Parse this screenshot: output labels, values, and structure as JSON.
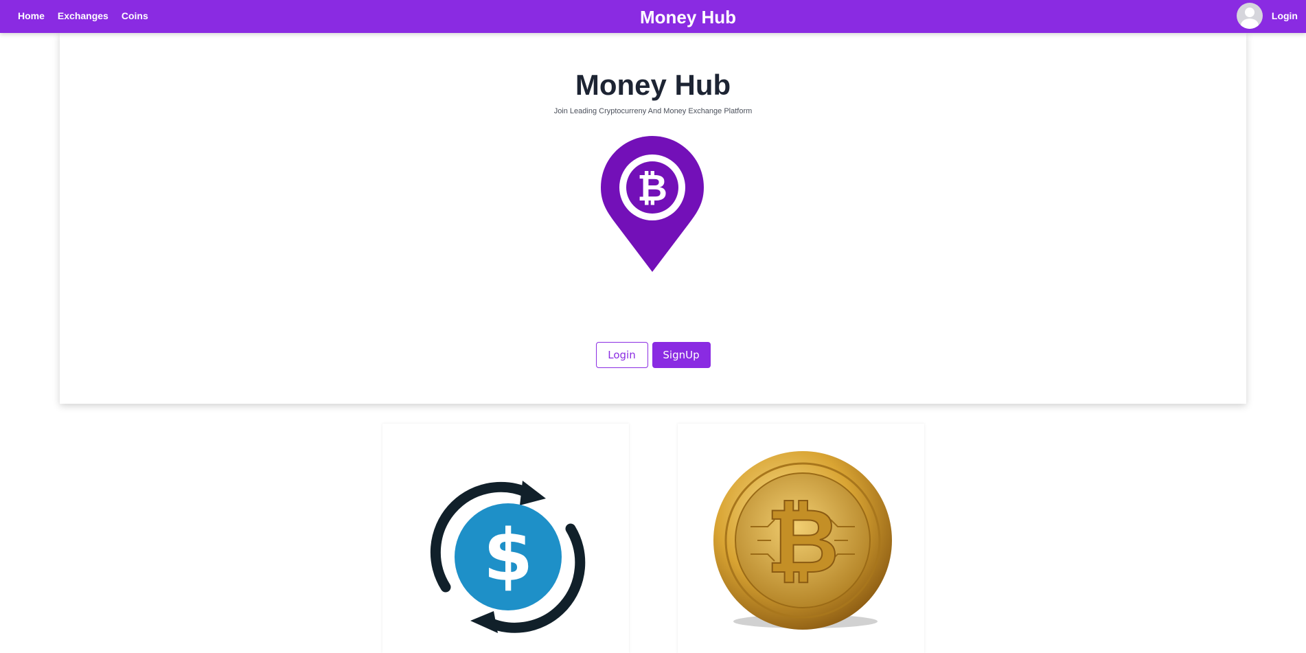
{
  "navbar": {
    "links": [
      {
        "label": "Home"
      },
      {
        "label": "Exchanges"
      },
      {
        "label": "Coins"
      }
    ],
    "brand": "Money Hub",
    "login_label": "Login"
  },
  "hero": {
    "title": "Money Hub",
    "subtitle": "Join Leading Cryptocurreny And Money Exchange Platform",
    "logo_icon": "bitcoin-location-pin-icon",
    "login_button": "Login",
    "signup_button": "SignUp"
  },
  "cards": [
    {
      "icon": "dollar-exchange-icon"
    },
    {
      "icon": "bitcoin-coin-icon"
    }
  ],
  "colors": {
    "accent": "#8a2be2",
    "logo_purple": "#7310b8",
    "dollar_blue": "#1e90c8",
    "arrow_dark": "#11202a",
    "coin_gold": "#d9a433"
  }
}
